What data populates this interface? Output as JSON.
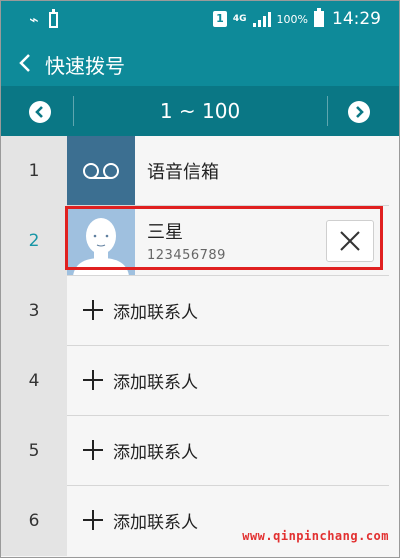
{
  "status_bar": {
    "sim_slot": "1",
    "network_type": "4G",
    "battery_percent": "100%",
    "time": "14:29",
    "icons": [
      "usb-icon",
      "battery-saver-icon",
      "sim-icon",
      "signal-icon",
      "battery-icon"
    ]
  },
  "header": {
    "title": "快速拨号"
  },
  "range_bar": {
    "range": "1 ~ 100"
  },
  "rows": [
    {
      "number": "1",
      "label": "语音信箱",
      "type": "voicemail"
    },
    {
      "number": "2",
      "name": "三星",
      "phone": "123456789",
      "type": "contact"
    },
    {
      "number": "3",
      "label": "添加联系人",
      "type": "add"
    },
    {
      "number": "4",
      "label": "添加联系人",
      "type": "add"
    },
    {
      "number": "5",
      "label": "添加联系人",
      "type": "add"
    },
    {
      "number": "6",
      "label": "添加联系人",
      "type": "add"
    }
  ],
  "watermark": "www.qinpinchang.com",
  "colors": {
    "header": "#0e8a99",
    "range_bar": "#0a7785",
    "highlight": "#e02020",
    "active_number": "#1796a6"
  }
}
